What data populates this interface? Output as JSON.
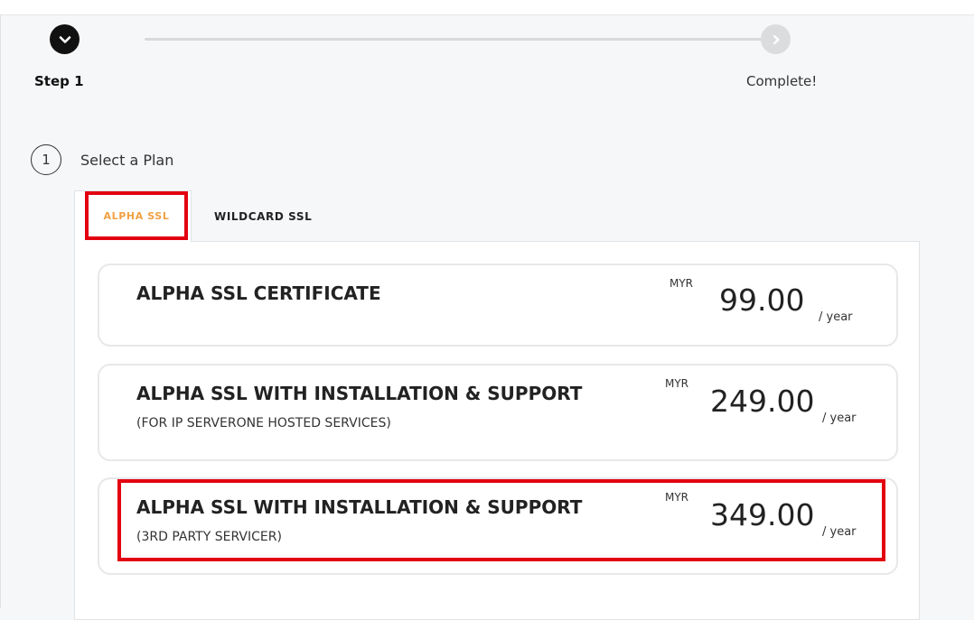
{
  "progress": {
    "current_step_label": "Step 1",
    "final_step_label": "Complete!"
  },
  "section": {
    "number": "1",
    "title": "Select a Plan"
  },
  "tabs": [
    {
      "label": "ALPHA SSL",
      "active": true
    },
    {
      "label": "WILDCARD SSL",
      "active": false
    }
  ],
  "plans": [
    {
      "title": "ALPHA SSL CERTIFICATE",
      "subtitle": "",
      "currency": "MYR",
      "price": "99.00",
      "period": "/ year"
    },
    {
      "title": "ALPHA SSL WITH INSTALLATION & SUPPORT",
      "subtitle": "(FOR IP SERVERONE HOSTED SERVICES)",
      "currency": "MYR",
      "price": "249.00",
      "period": "/ year"
    },
    {
      "title": "ALPHA SSL WITH INSTALLATION & SUPPORT",
      "subtitle": "(3RD PARTY SERVICER)",
      "currency": "MYR",
      "price": "349.00",
      "period": "/ year"
    }
  ],
  "colors": {
    "accent_orange": "#f2a042",
    "highlight_red": "#e3000f",
    "dark": "#111111"
  },
  "icons": {
    "step_icon": "chevron-down-icon",
    "complete_icon": "chevron-right-icon"
  }
}
